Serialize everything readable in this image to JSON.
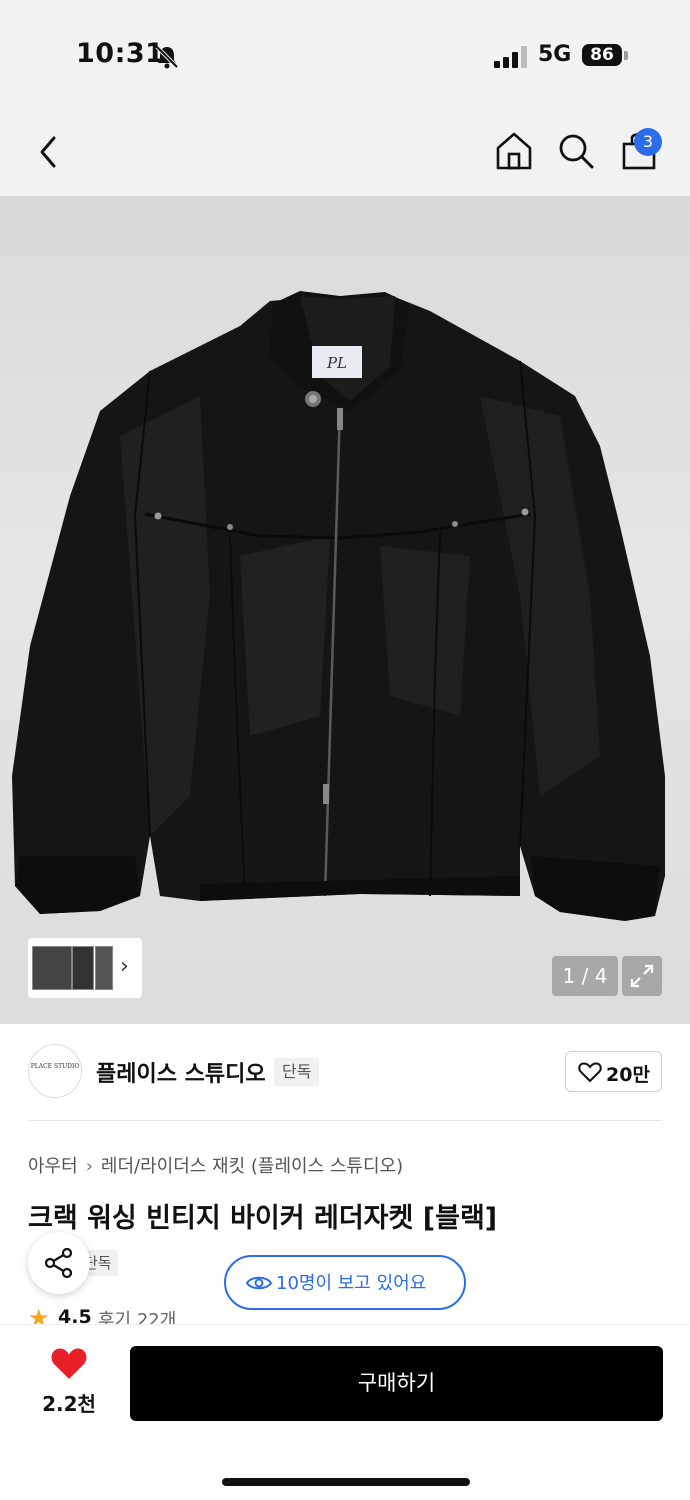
{
  "status_bar": {
    "time": "10:31",
    "network": "5G",
    "battery": "86",
    "icons": [
      "bell-slash-icon",
      "signal-bars-icon",
      "battery-icon"
    ]
  },
  "nav": {
    "cart_count": "3",
    "icons": [
      "back-chevron-icon",
      "home-icon",
      "search-icon",
      "shopping-bag-icon"
    ]
  },
  "gallery": {
    "page_indicator": "1 / 4",
    "thumbnail_next": "›",
    "label_text": "PL"
  },
  "brand": {
    "name": "플레이스 스튜디오",
    "tag": "단독",
    "likes": "20만",
    "logo_text": "PLACE STUDIO"
  },
  "product": {
    "breadcrumb": [
      "아우터",
      "레더/라이더스 재킷 (플레이스 스튜디오)"
    ],
    "breadcrumb_separator": "›",
    "title": "크랙 워싱 빈티지 바이커 레더자켓 [블랙]",
    "tag": "단독",
    "viewers": "10명이 보고 있어요",
    "rating": "4.5",
    "reviews": "후기 22개"
  },
  "bottom_bar": {
    "wish_count": "2.2천",
    "buy_label": "구매하기"
  },
  "colors": {
    "accent_blue": "#2b6de8",
    "heart_red": "#e8202a",
    "star_orange": "#f5a623",
    "buy_button": "#000000"
  }
}
